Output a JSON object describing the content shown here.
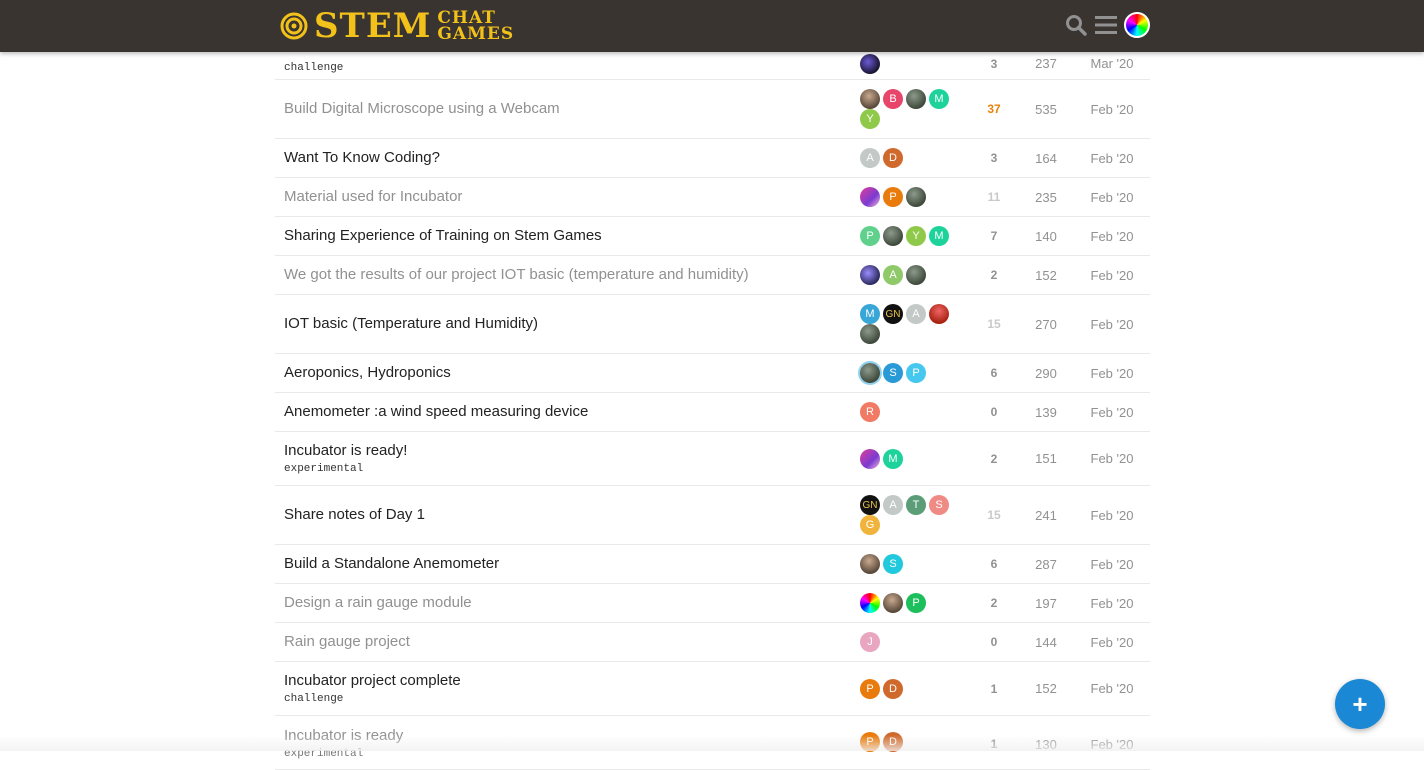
{
  "header": {
    "logo_stem": "STEM",
    "logo_chat": "CHAT",
    "logo_games": "GAMES",
    "icons": [
      "search-icon",
      "hamburger-menu-icon",
      "user-avatar"
    ]
  },
  "topics": [
    {
      "title": "",
      "tag": "challenge",
      "replies": "3",
      "views": "237",
      "activity": "Mar '20"
    },
    {
      "title": "Build Digital Microscope using a Webcam",
      "tag": "",
      "replies": "37",
      "views": "535",
      "activity": "Feb '20"
    },
    {
      "title": "Want To Know Coding?",
      "tag": "",
      "replies": "3",
      "views": "164",
      "activity": "Feb '20"
    },
    {
      "title": "Material used for Incubator",
      "tag": "",
      "replies": "11",
      "views": "235",
      "activity": "Feb '20"
    },
    {
      "title": "Sharing Experience of Training on Stem Games",
      "tag": "",
      "replies": "7",
      "views": "140",
      "activity": "Feb '20"
    },
    {
      "title": "We got the results of our project IOT basic (temperature and humidity)",
      "tag": "",
      "replies": "2",
      "views": "152",
      "activity": "Feb '20"
    },
    {
      "title": "IOT basic (Temperature and Humidity)",
      "tag": "",
      "replies": "15",
      "views": "270",
      "activity": "Feb '20"
    },
    {
      "title": "Aeroponics, Hydroponics",
      "tag": "",
      "replies": "6",
      "views": "290",
      "activity": "Feb '20"
    },
    {
      "title": "Anemometer :a wind speed measuring device",
      "tag": "",
      "replies": "0",
      "views": "139",
      "activity": "Feb '20"
    },
    {
      "title": "Incubator is ready!",
      "tag": "experimental",
      "replies": "2",
      "views": "151",
      "activity": "Feb '20"
    },
    {
      "title": "Share notes of Day 1",
      "tag": "",
      "replies": "15",
      "views": "241",
      "activity": "Feb '20"
    },
    {
      "title": "Build a Standalone Anemometer",
      "tag": "",
      "replies": "6",
      "views": "287",
      "activity": "Feb '20"
    },
    {
      "title": "Design a rain gauge module",
      "tag": "",
      "replies": "2",
      "views": "197",
      "activity": "Feb '20"
    },
    {
      "title": "Rain gauge project",
      "tag": "",
      "replies": "0",
      "views": "144",
      "activity": "Feb '20"
    },
    {
      "title": "Incubator project complete",
      "tag": "challenge",
      "replies": "1",
      "views": "152",
      "activity": "Feb '20"
    },
    {
      "title": "Incubator is ready",
      "tag": "experimental",
      "replies": "1",
      "views": "130",
      "activity": "Feb '20"
    }
  ],
  "avatars": {
    "r1": [
      "B",
      "M",
      "Y"
    ],
    "r2": [
      "A",
      "D"
    ],
    "r3": [
      "P"
    ],
    "r4": [
      "P",
      "Y",
      "M"
    ],
    "r5": [
      "A"
    ],
    "r6": [
      "M",
      "GN",
      "A"
    ],
    "r7": [
      "S",
      "P"
    ],
    "r8": [
      "R"
    ],
    "r9": [
      "M"
    ],
    "r10": [
      "GN",
      "A",
      "T",
      "S",
      "G"
    ],
    "r11": [
      "S"
    ],
    "r12": [
      "P"
    ],
    "r13": [
      "J"
    ],
    "r14": [
      "P",
      "D"
    ],
    "r15": [
      "P",
      "D"
    ]
  },
  "colors": {
    "header_bg": "#3a3431",
    "logo": "#f2c21b",
    "hot_replies": "#e8820c",
    "fab": "#1a88d4"
  },
  "fab": {
    "label": "+"
  }
}
